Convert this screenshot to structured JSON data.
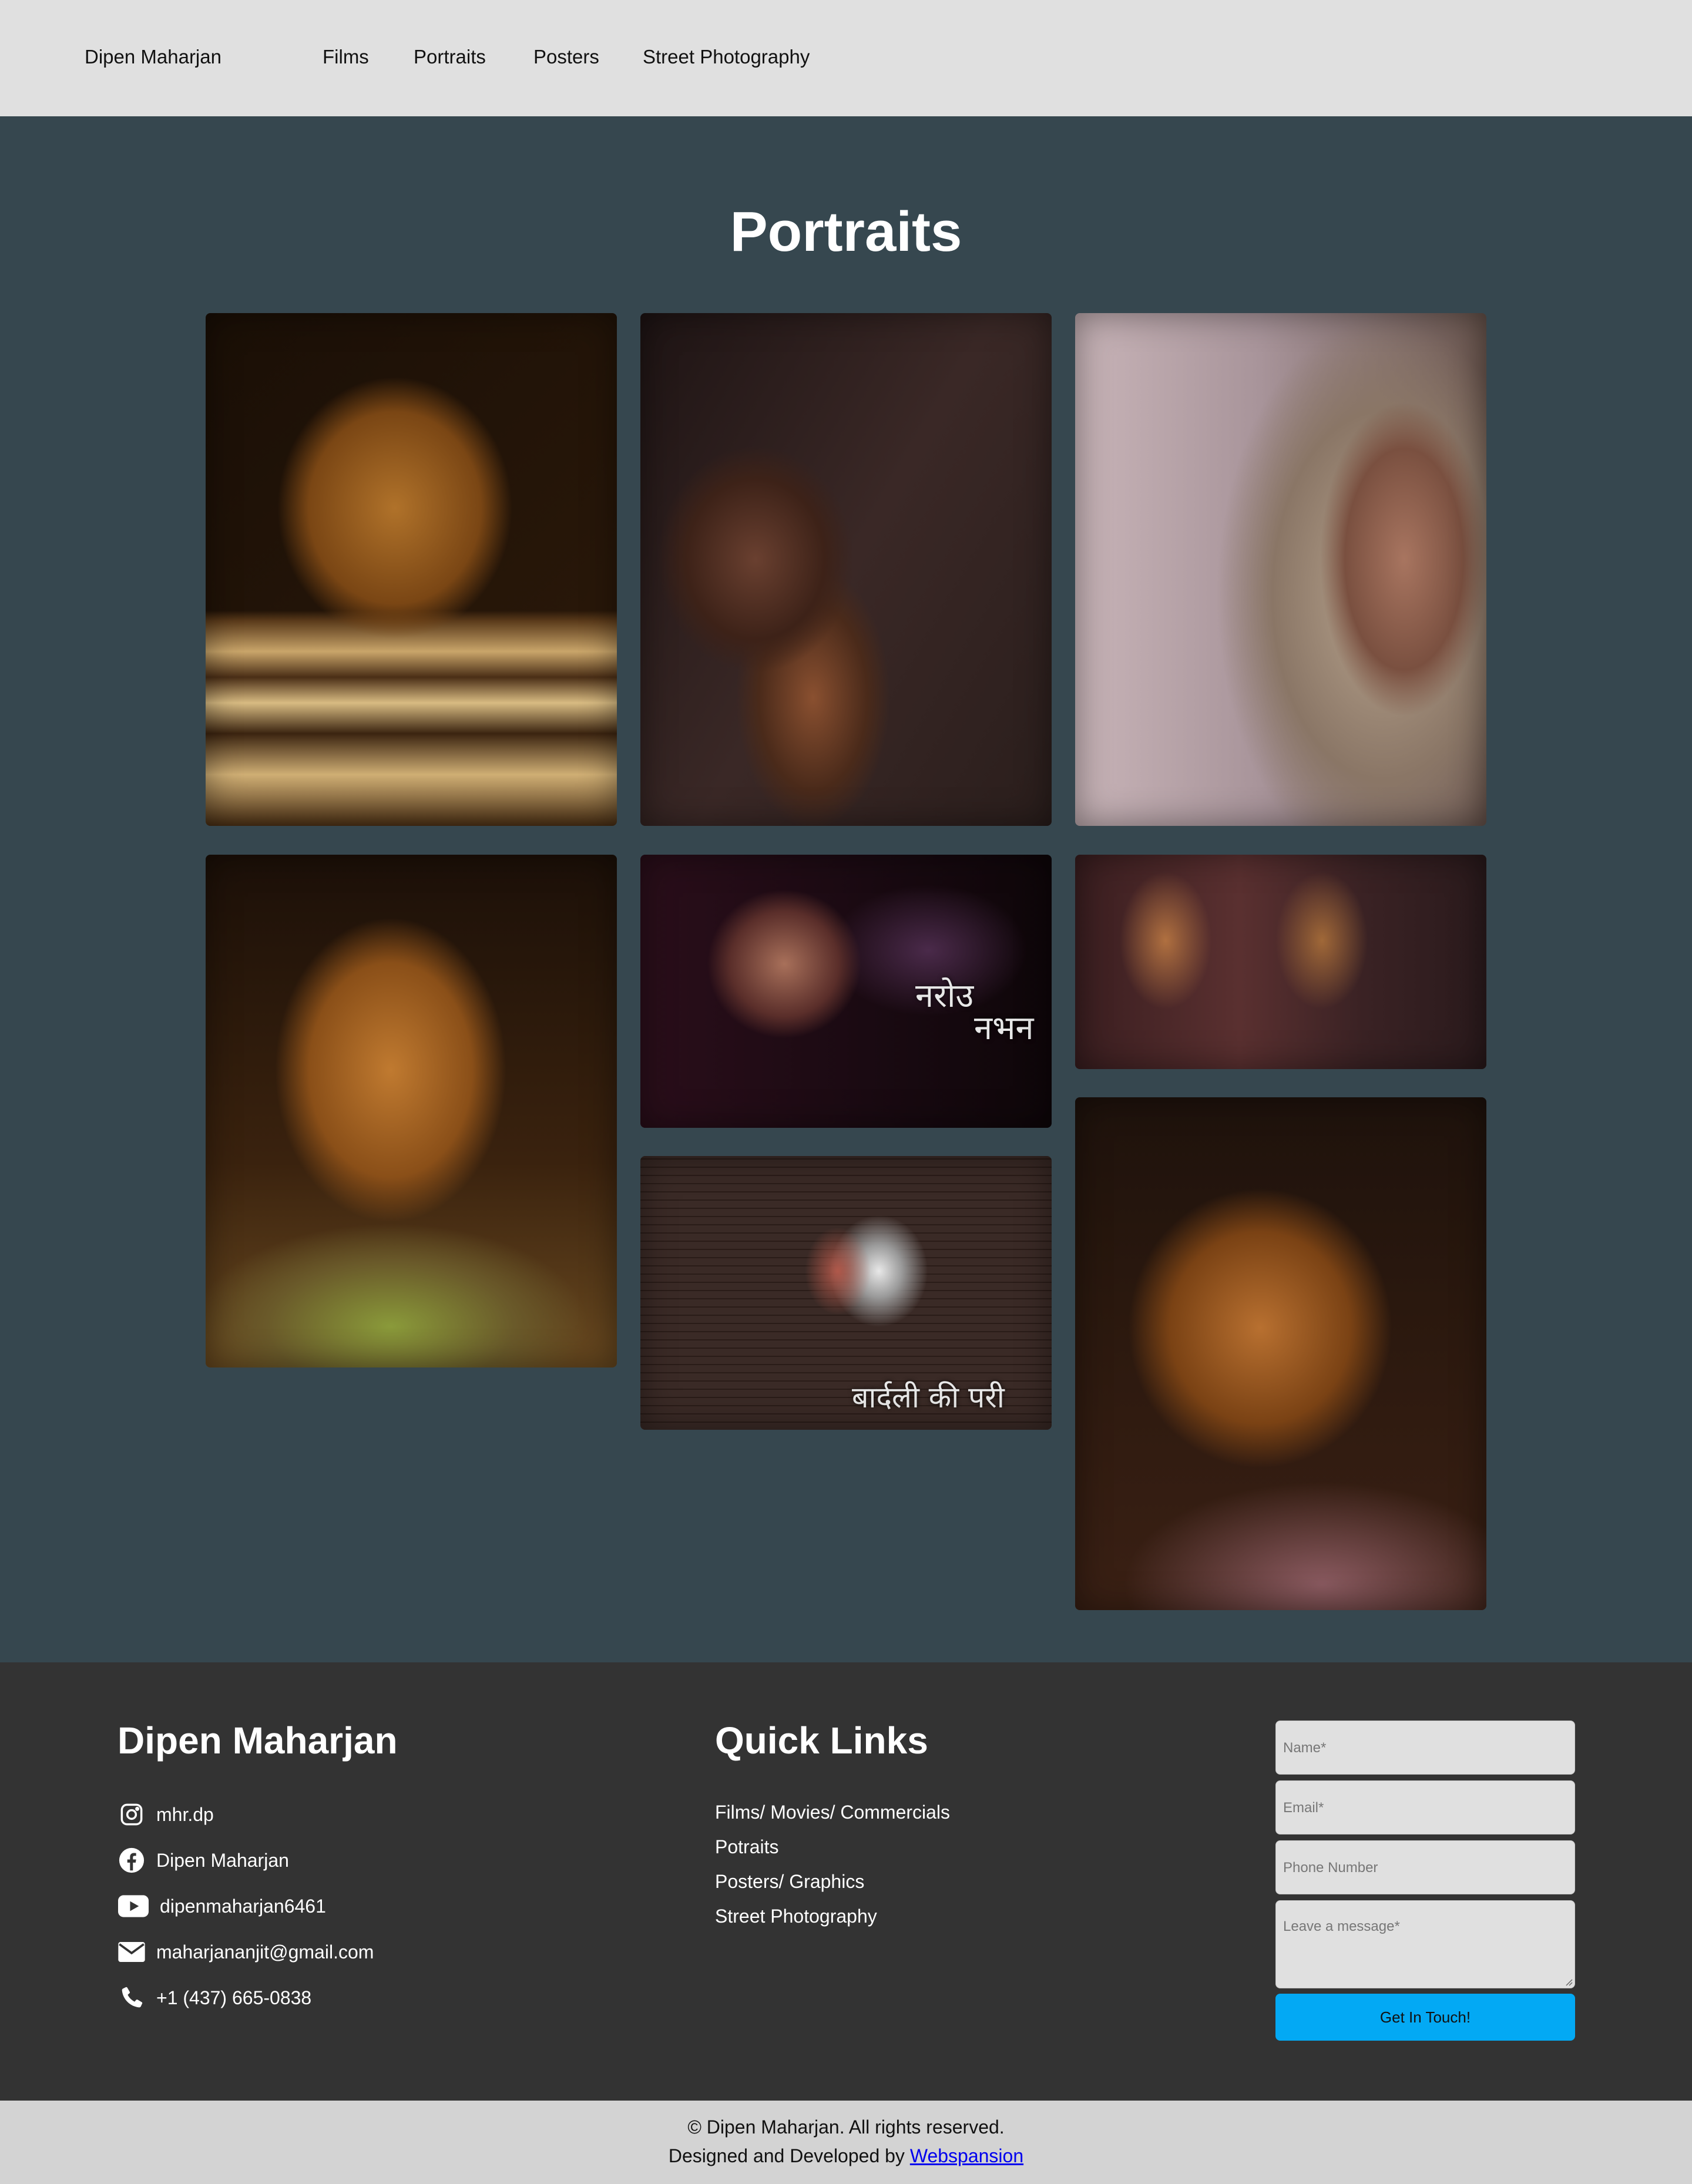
{
  "nav": {
    "brand": "Dipen Maharjan",
    "links": [
      "Films",
      "Portraits",
      "Posters",
      "Street Photography"
    ]
  },
  "main": {
    "title": "Portraits",
    "photos": [
      {
        "subject": "elderly-man-portrait"
      },
      {
        "subject": "woman-hand-on-face-portrait"
      },
      {
        "subject": "woman-headscarf-portrait"
      },
      {
        "subject": "woman-green-sweater-portrait"
      },
      {
        "subject": "poster-woman-smoking",
        "overlay_line1": "नरोउ",
        "overlay_line2": "नभन"
      },
      {
        "subject": "silhouettes-hands-raised"
      },
      {
        "subject": "poster-angel-wings",
        "overlay": "बार्दली  की  परी"
      },
      {
        "subject": "child-portrait"
      }
    ]
  },
  "footer": {
    "brand": "Dipen Maharjan",
    "contacts": [
      {
        "icon": "instagram-icon",
        "text": "mhr.dp"
      },
      {
        "icon": "facebook-icon",
        "text": "Dipen Maharjan"
      },
      {
        "icon": "youtube-icon",
        "text": "dipenmaharjan6461"
      },
      {
        "icon": "mail-icon",
        "text": "maharjananjit@gmail.com"
      },
      {
        "icon": "phone-icon",
        "text": "+1 (437) 665-0838"
      }
    ],
    "quick_links_title": "Quick Links",
    "quick_links": [
      "Films/ Movies/ Commercials",
      "Potraits",
      "Posters/ Graphics",
      "Street Photography"
    ],
    "form": {
      "name_placeholder": "Name*",
      "email_placeholder": "Email*",
      "phone_placeholder": "Phone Number",
      "message_placeholder": "Leave a message*",
      "submit_label": "Get In Touch!"
    }
  },
  "bottom": {
    "copyright": "© Dipen Maharjan. All rights reserved.",
    "designed_by": "Designed and Developed by ",
    "developer": "Webspansion"
  },
  "colors": {
    "nav_bg": "#e0e0e0",
    "main_bg": "#36474f",
    "footer_bg": "#333333",
    "accent": "#03a9f4",
    "bottom_bg": "#d3d3d3"
  }
}
